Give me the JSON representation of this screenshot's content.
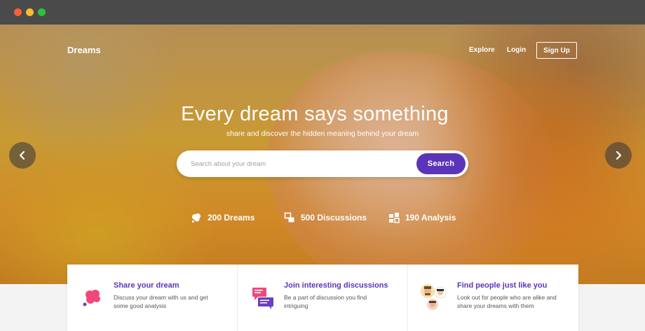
{
  "brand": "Dreams",
  "nav": {
    "explore": "Explore",
    "login": "Login",
    "signup": "Sign Up"
  },
  "hero": {
    "headline": "Every dream says something",
    "subline": "share and discover the hidden meaning behind your dream"
  },
  "search": {
    "placeholder": "Search about your dream",
    "button": "Search"
  },
  "stats": [
    {
      "label": "200 Dreams",
      "icon": "cloud-icon"
    },
    {
      "label": "500 Discussions",
      "icon": "discussion-icon"
    },
    {
      "label": "190 Analysis",
      "icon": "analysis-icon"
    }
  ],
  "features": [
    {
      "title": "Share your dream",
      "desc": "Discuss your dream with us and get some good analysis",
      "icon": "dream-cloud-icon"
    },
    {
      "title": "Join interesting discussions",
      "desc": "Be a part of discussion you find intriguing",
      "icon": "chat-bubbles-icon"
    },
    {
      "title": "Find people just like you",
      "desc": "Look out for people who are alike and share your dreams with them",
      "icon": "people-icon"
    }
  ],
  "colors": {
    "accent": "#5b35b9",
    "pink": "#f0487a",
    "titlebar": "#4a4a4a"
  }
}
